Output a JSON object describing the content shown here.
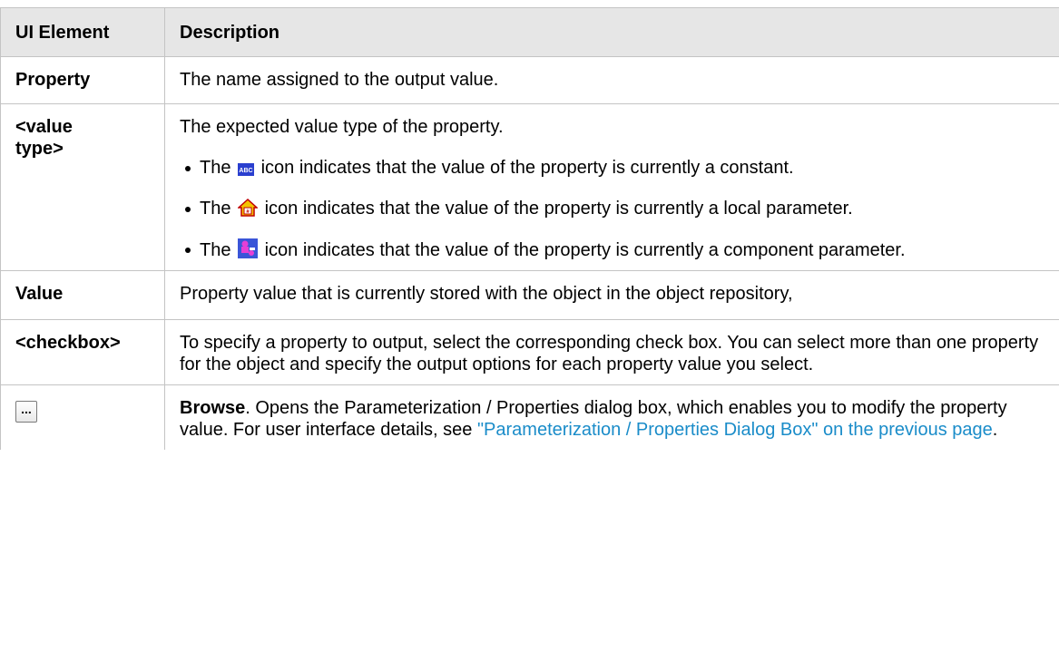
{
  "table": {
    "header": {
      "col1": "UI Element",
      "col2": "Description"
    },
    "rows": {
      "property": {
        "element": "Property",
        "description": "The name assigned to the output value."
      },
      "value_type": {
        "element": "<value type>",
        "description": "The expected value type of the property.",
        "bullets": [
          {
            "prefix": "The",
            "icon": "abc-constant-icon",
            "text": "icon indicates that the value of the property is currently a constant."
          },
          {
            "prefix": "The",
            "icon": "home-local-parameter-icon",
            "text": "icon indicates that the value of the property is currently a local parameter."
          },
          {
            "prefix": "The",
            "icon": "component-parameter-icon",
            "text": "icon indicates that the value of the property is currently a component parameter."
          }
        ]
      },
      "value": {
        "element": "Value",
        "description": "Property value that is currently stored with the object in the object repository,"
      },
      "checkbox": {
        "element": "<checkbox>",
        "description": "To specify a property to output, select the corresponding check box. You can select more than one property for the object and specify the output options for each property value you select."
      },
      "browse": {
        "element_icon": "ellipsis-button-icon",
        "button_label": "...",
        "bold_label": "Browse",
        "description": ". Opens the Parameterization / Properties dialog box, which enables you to modify the property value. For user interface details, see ",
        "link_text": "\"Parameterization / Properties Dialog Box\" on the previous page",
        "tail": "."
      }
    }
  },
  "colors": {
    "header_bg": "#e6e6e6",
    "border": "#c4c4c4",
    "link": "#1a8cc9"
  }
}
